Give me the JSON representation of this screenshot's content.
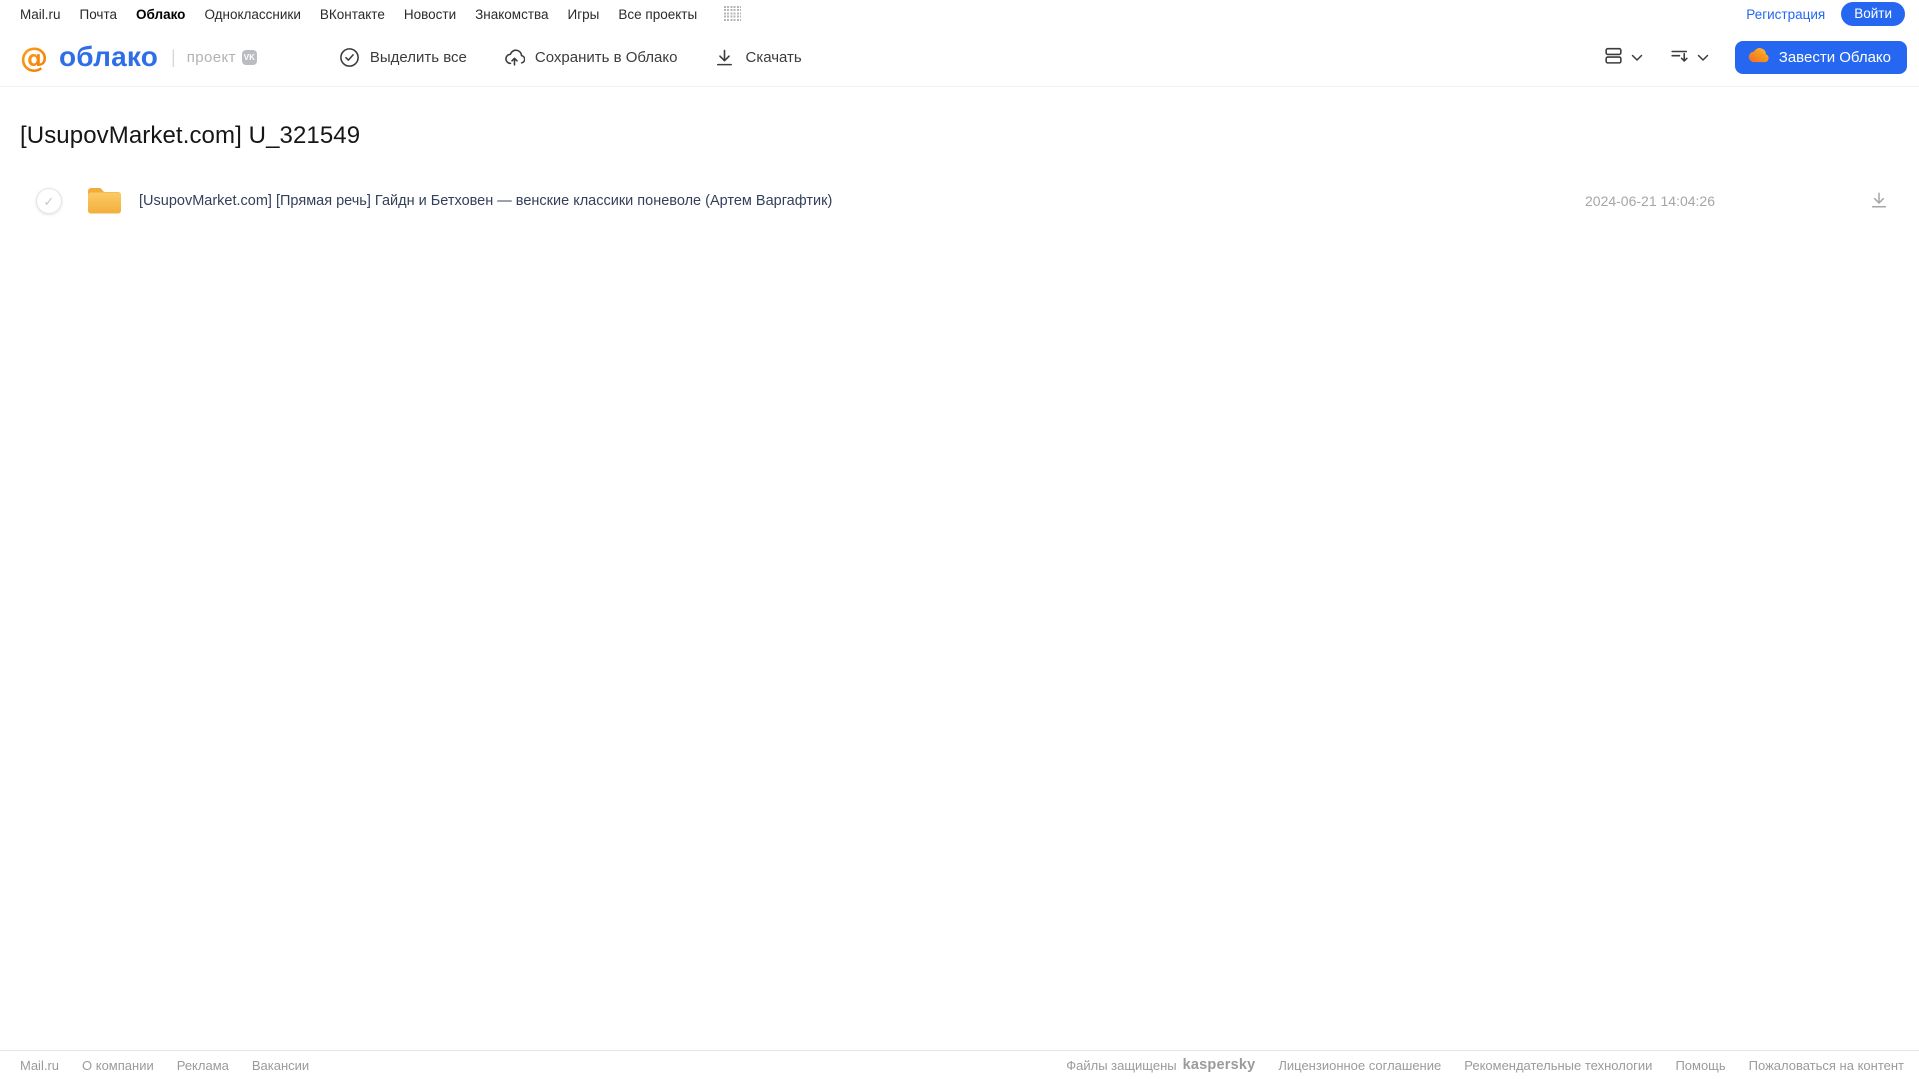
{
  "topnav": {
    "items": [
      "Mail.ru",
      "Почта",
      "Облако",
      "Одноклассники",
      "ВКонтакте",
      "Новости",
      "Знакомства",
      "Игры",
      "Все проекты"
    ],
    "register_label": "Регистрация",
    "login_label": "Войти"
  },
  "header": {
    "logo_text": "облако",
    "project_label": "проект",
    "vk_badge": "VK",
    "toolbar": {
      "select_all_label": "Выделить все",
      "save_label": "Сохранить в Облако",
      "download_label": "Скачать"
    },
    "cta_label": "Завести Облако"
  },
  "main": {
    "title": "[UsupovMarket.com] U_321549",
    "files": [
      {
        "type": "folder",
        "name": "[UsupovMarket.com] [Прямая речь] Гайдн и Бетховен — венские классики поневоле (Артем Варгафтик)",
        "date": "2024-06-21 14:04:26"
      }
    ]
  },
  "footer": {
    "left_links": [
      "Mail.ru",
      "О компании",
      "Реклама",
      "Вакансии"
    ],
    "protected_label": "Файлы защищены",
    "kaspersky_label": "kaspersky",
    "right_links": [
      "Лицензионное соглашение",
      "Рекомендательные технологии",
      "Помощь",
      "Пожаловаться на контент"
    ]
  },
  "colors": {
    "accent_blue": "#2567F0",
    "logo_orange": "#F89A1C",
    "folder_yellow": "#F7BA4D",
    "kaspersky_green": "#00A88E"
  }
}
